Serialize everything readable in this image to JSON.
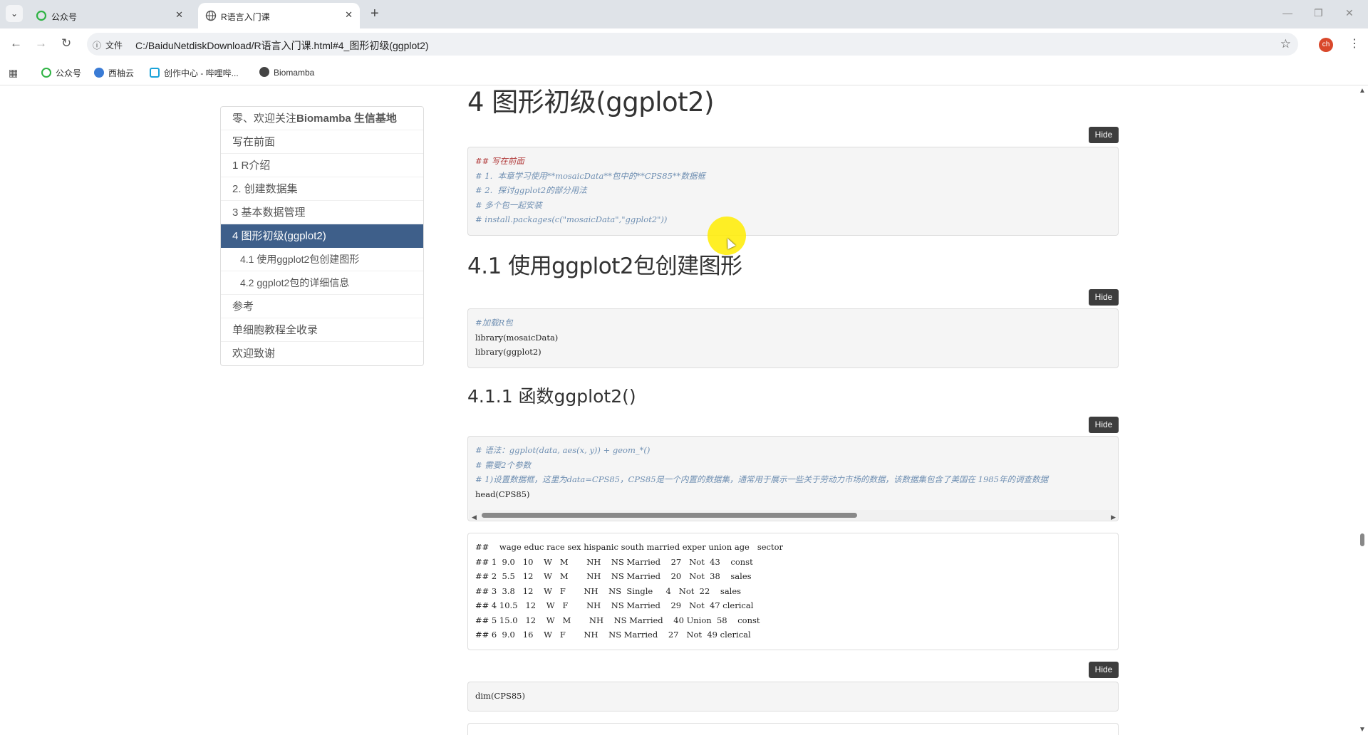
{
  "browser": {
    "tabs": [
      {
        "title": "公众号"
      },
      {
        "title": "R语言入门课"
      }
    ],
    "omnibox": {
      "security_label": "文件",
      "url": "C:/BaiduNetdiskDownload/R语言入门课.html#4_图形初级(ggplot2)"
    },
    "profile_initials": "ch",
    "bookmarks": [
      "公众号",
      "西柚云",
      "创作中心 - 哔哩哔...",
      "Biomamba"
    ]
  },
  "toc": {
    "items": [
      {
        "prefix": "零、欢迎关注",
        "bold": "Biomamba 生信基地"
      },
      {
        "label": "写在前面"
      },
      {
        "label": "1 R介绍"
      },
      {
        "label": "2. 创建数据集"
      },
      {
        "label": "3 基本数据管理"
      },
      {
        "label": "4 图形初级(ggplot2)"
      },
      {
        "label": "4.1 使用ggplot2包创建图形"
      },
      {
        "label": "4.2 ggplot2包的详细信息"
      },
      {
        "label": "参考"
      },
      {
        "label": "单细胞教程全收录"
      },
      {
        "label": "欢迎致谢"
      }
    ]
  },
  "content": {
    "h1": "4 图形初级(ggplot2)",
    "hide_label": "Hide",
    "block1": {
      "lines": [
        "## 写在前面",
        "# 1.  本章学习使用**mosaicData**包中的**CPS85**数据框",
        "# 2.  探讨ggplot2的部分用法",
        "# 多个包一起安装",
        "# install.packages(c(\"mosaicData\",\"ggplot2\"))"
      ]
    },
    "h2": "4.1 使用ggplot2包创建图形",
    "block2": {
      "comment": "#加载R包",
      "code": [
        "library(mosaicData)",
        "library(ggplot2)"
      ]
    },
    "h3": "4.1.1 函数ggplot2()",
    "block3": {
      "comments": [
        "# 语法：ggplot(data, aes(x, y)) + geom_*()",
        "# 需要2个参数",
        "# 1)设置数据框，这里为data=CPS85，CPS85是一个内置的数据集，通常用于展示一些关于劳动力市场的数据，该数据集包含了美国在 1985年的调查数据"
      ],
      "code": "head(CPS85)"
    },
    "output1": {
      "lines": [
        "##    wage educ race sex hispanic south married exper union age   sector",
        "## 1  9.0   10    W   M       NH    NS Married    27   Not  43    const",
        "## 2  5.5   12    W   M       NH    NS Married    20   Not  38    sales",
        "## 3  3.8   12    W   F       NH    NS  Single     4   Not  22    sales",
        "## 4 10.5   12    W   F       NH    NS Married    29   Not  47 clerical",
        "## 5 15.0   12    W   M       NH    NS Married    40 Union  58    const",
        "## 6  9.0   16    W   F       NH    NS Married    27   Not  49 clerical"
      ]
    },
    "block4": {
      "code": "dim(CPS85)"
    }
  }
}
